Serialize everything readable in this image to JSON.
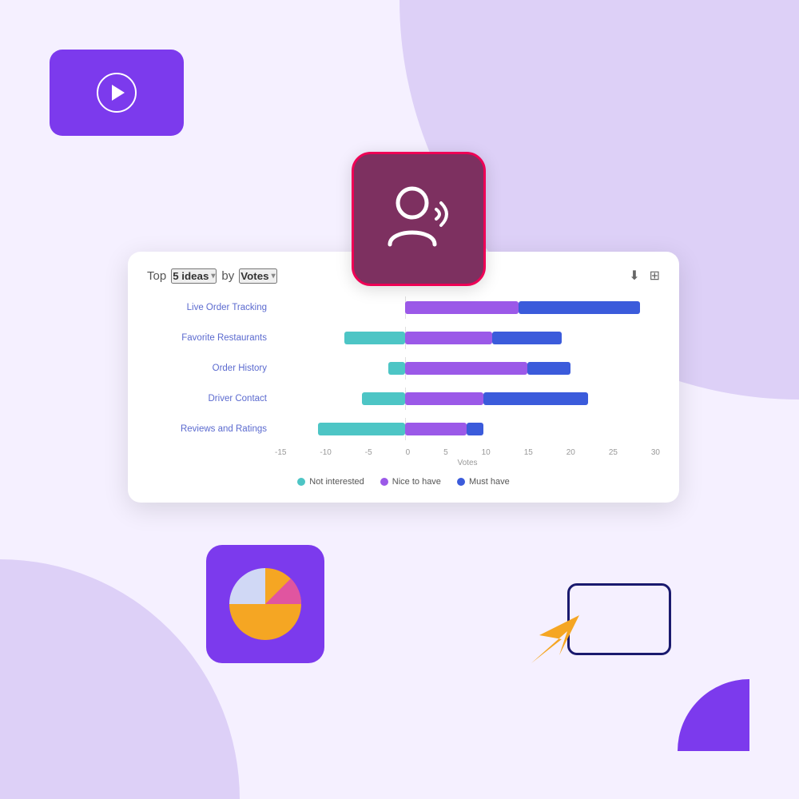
{
  "background": {
    "color_main": "#f5f0ff",
    "blob_color": "#ddd0f7"
  },
  "play_card": {
    "bg_color": "#7c3aed",
    "aria_label": "Play video"
  },
  "user_card": {
    "bg_color": "#7d3060",
    "aria_label": "User voice icon"
  },
  "pie_card": {
    "bg_color": "#7c3aed",
    "aria_label": "Pie chart icon"
  },
  "chart": {
    "header": {
      "prefix": "Top",
      "ideas_dropdown": "5 ideas",
      "by_label": "by",
      "votes_dropdown": "Votes"
    },
    "bars": [
      {
        "label": "Live Order Tracking",
        "not_interested": 0,
        "nice_to_have": 13,
        "must_have": 14
      },
      {
        "label": "Favorite Restaurants",
        "not_interested": 7,
        "nice_to_have": 10,
        "must_have": 8
      },
      {
        "label": "Order History",
        "not_interested": 2,
        "nice_to_have": 14,
        "must_have": 5
      },
      {
        "label": "Driver Contact",
        "not_interested": 5,
        "nice_to_have": 9,
        "must_have": 12
      },
      {
        "label": "Reviews and Ratings",
        "not_interested": 10,
        "nice_to_have": 7,
        "must_have": 2
      }
    ],
    "x_axis_labels": [
      "-15",
      "-10",
      "-5",
      "0",
      "5",
      "10",
      "15",
      "20",
      "25",
      "30"
    ],
    "x_axis_title": "Votes",
    "legend": [
      {
        "label": "Not interested",
        "color": "#4dc5c5"
      },
      {
        "label": "Nice to have",
        "color": "#9b59e8"
      },
      {
        "label": "Must have",
        "color": "#3b5bdb"
      }
    ]
  },
  "decorations": {
    "quarter_circle_color": "#7c3aed",
    "cursor_box_color": "#1a1a6e",
    "cursor_arrow_color": "#f5a623"
  }
}
